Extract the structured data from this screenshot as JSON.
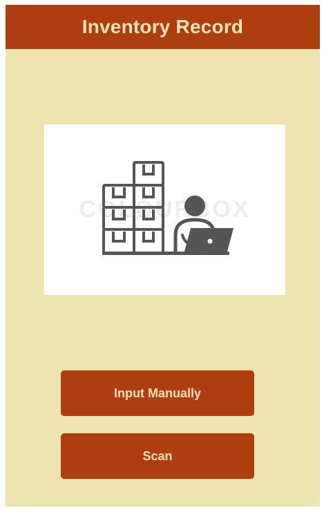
{
  "header": {
    "title": "Inventory Record"
  },
  "hero_image": {
    "icon": "warehouse-boxes-person-laptop-icon",
    "watermark": "COLOURBOX"
  },
  "actions": {
    "input_manually_label": "Input Manually",
    "scan_label": "Scan"
  },
  "colors": {
    "header_bg": "#ae3e0f",
    "page_bg": "#ede4b0",
    "button_bg": "#ae3e0f",
    "text_light": "#f6e3b6",
    "icon_gray": "#555555"
  }
}
